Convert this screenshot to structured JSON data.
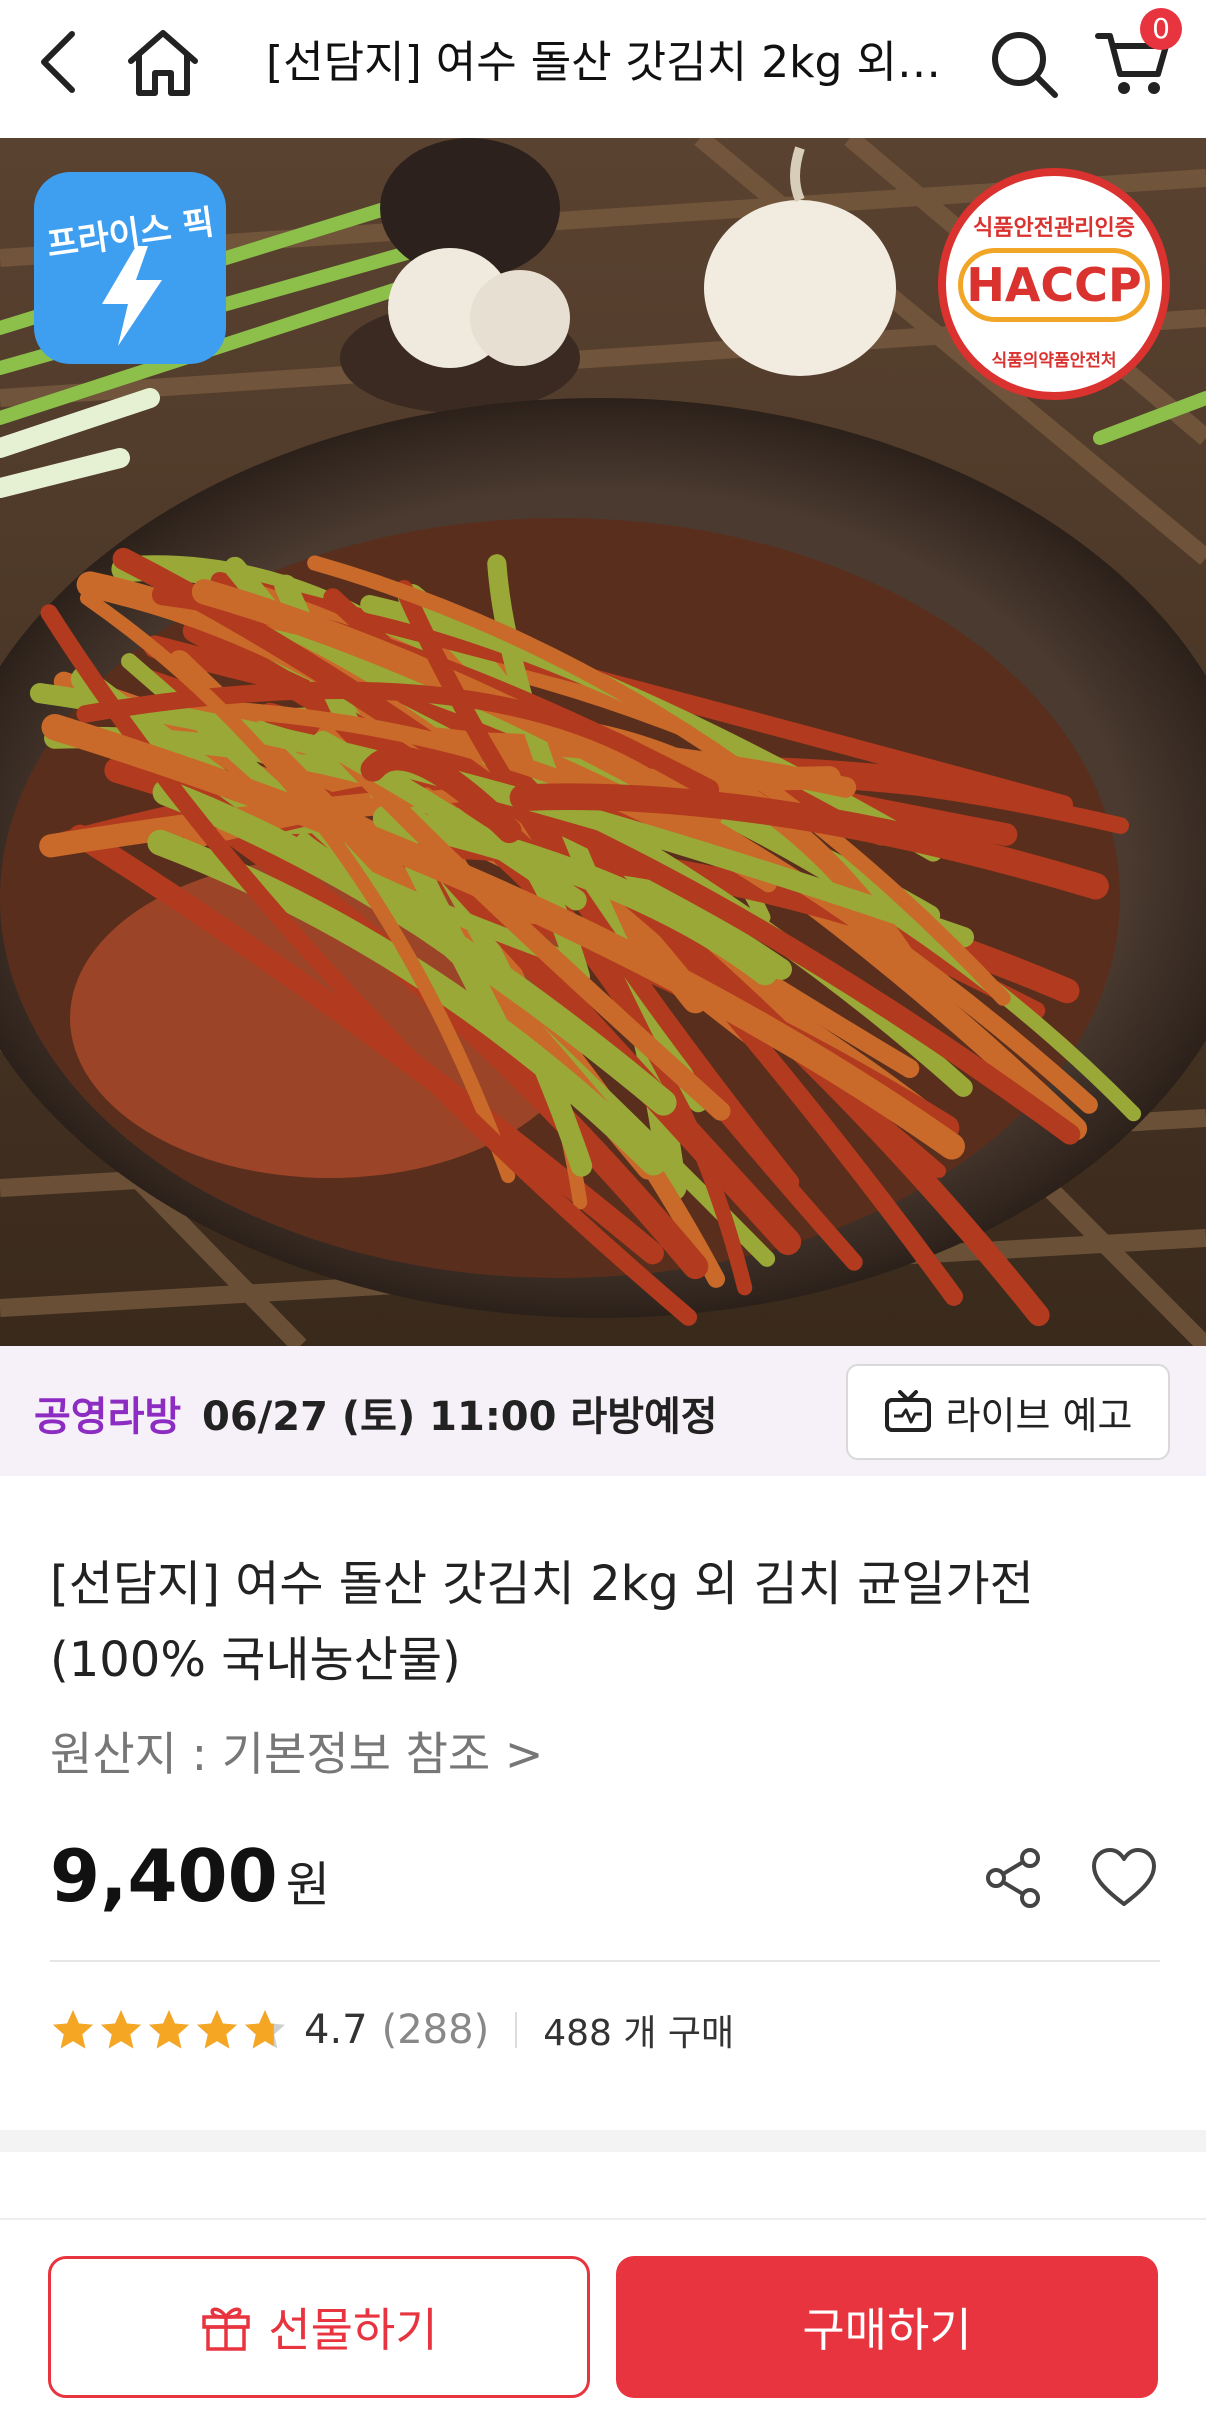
{
  "header": {
    "title": "[선담지] 여수 돌산 갓김치 2kg 외 ...",
    "cart_count": "0",
    "icons": [
      "back-icon",
      "home-icon",
      "search-icon",
      "cart-icon"
    ]
  },
  "photo": {
    "badge_pricepick": "프라이스 픽",
    "haccp": {
      "top": "식품안전관리인증",
      "mid": "HACCP",
      "bottom": "식품의약품안전처"
    }
  },
  "live": {
    "tag": "공영라방",
    "schedule": "06/27 (토) 11:00 라방예정",
    "button_label": "라이브 예고"
  },
  "product": {
    "title": "[선담지] 여수 돌산 갓김치 2kg 외 김치 균일가전 (100% 국내농산물)",
    "origin": "원산지 : 기본정보 참조 >",
    "price": "9,400",
    "currency": "원",
    "rating": "4.7",
    "rating_value": 4.7,
    "review_count": "(288)",
    "sold": "488 개 구매"
  },
  "bottom": {
    "gift_label": "선물하기",
    "buy_label": "구매하기"
  },
  "colors": {
    "accent": "#e8343f",
    "live_purple": "#8c2cc2",
    "star": "#f5a623"
  }
}
